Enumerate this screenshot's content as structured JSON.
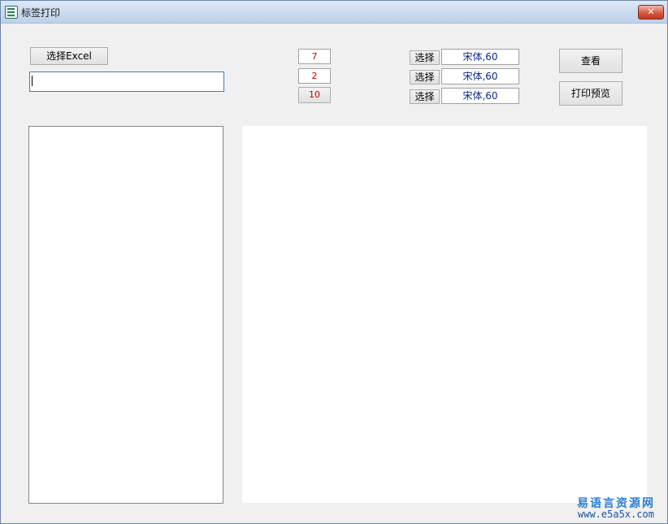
{
  "window": {
    "title": "标签打印",
    "close_label": "✕"
  },
  "file": {
    "select_excel_label": "选择Excel",
    "path_value": ""
  },
  "numbers": [
    {
      "value": "7"
    },
    {
      "value": "2"
    },
    {
      "value": "10"
    }
  ],
  "fonts": [
    {
      "select_label": "选择",
      "font_value": "宋体,60"
    },
    {
      "select_label": "选择",
      "font_value": "宋体,60"
    },
    {
      "select_label": "选择",
      "font_value": "宋体,60"
    }
  ],
  "actions": {
    "view_label": "查看",
    "print_preview_label": "打印预览"
  },
  "watermark": {
    "site_name": "易语言资源网",
    "url": "www.e5a5x.com"
  },
  "colors": {
    "value_red": "#cc0000",
    "font_value_blue": "#0a2a8a",
    "titlebar": "#c9d9ee"
  }
}
